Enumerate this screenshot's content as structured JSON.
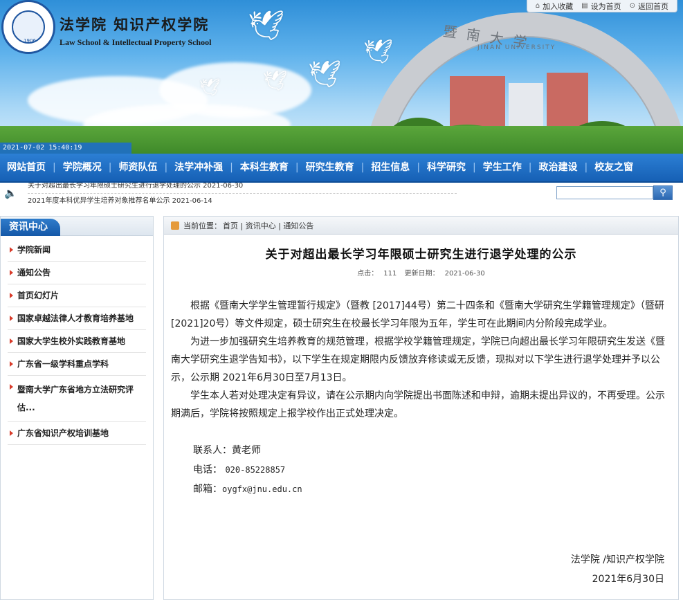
{
  "header": {
    "school_cn": "法学院  知识产权学院",
    "school_en": "Law School & Intellectual Property School",
    "logo_year": "1906",
    "logo_ring": "JINAN UNIVERSITY",
    "arch_text": "暨南大学",
    "arch_en": "JINAN UNIVERSITY",
    "datetime": "2021-07-02 15:40:19",
    "top_links": [
      {
        "label": "加入收藏",
        "icon": "home-icon"
      },
      {
        "label": "设为首页",
        "icon": "bookmark-icon"
      },
      {
        "label": "返回首页",
        "icon": "return-icon"
      }
    ]
  },
  "nav": {
    "items": [
      "网站首页",
      "学院概况",
      "师资队伍",
      "法学冲补强",
      "本科生教育",
      "研究生教育",
      "招生信息",
      "科学研究",
      "学生工作",
      "政治建设",
      "校友之窗"
    ]
  },
  "marquee": {
    "items": [
      "关于对超出最长学习年限硕士研究生进行退学处理的公示  2021-06-30",
      "2021年度本科优异学生培养对象推荐名单公示  2021-06-14"
    ]
  },
  "search": {
    "placeholder": "",
    "button_icon": "search-icon"
  },
  "sidebar": {
    "title": "资讯中心",
    "items": [
      "学院新闻",
      "通知公告",
      "首页幻灯片",
      "国家卓越法律人才教育培养基地",
      "国家大学生校外实践教育基地",
      "广东省一级学科重点学科",
      "暨南大学广东省地方立法研究评估...",
      "广东省知识产权培训基地"
    ]
  },
  "breadcrumb": {
    "label": "当前位置：",
    "path": "首页 | 资讯中心 | 通知公告"
  },
  "article": {
    "title": "关于对超出最长学习年限硕士研究生进行退学处理的公示",
    "clicks_label": "点击：",
    "clicks": "111",
    "updated_label": "更新日期：",
    "updated": "2021-06-30",
    "paragraphs": [
      "根据《暨南大学学生管理暂行规定》（暨教 [2017]44号）第二十四条和《暨南大学研究生学籍管理规定》（暨研[2021]20号）等文件规定，硕士研究生在校最长学习年限为五年，学生可在此期间内分阶段完成学业。",
      "为进一步加强研究生培养教育的规范管理，根据学校学籍管理规定，学院已向超出最长学习年限研究生发送《暨南大学研究生退学告知书》，以下学生在规定期限内反馈放弃修读或无反馈，现拟对以下学生进行退学处理并予以公示，公示期 2021年6月30日至7月13日。",
      "学生本人若对处理决定有异议，请在公示期内向学院提出书面陈述和申辩，逾期未提出异议的，不再受理。公示期满后，学院将按照规定上报学校作出正式处理决定。"
    ],
    "contact_person_label": "联系人：",
    "contact_person": "黄老师",
    "phone_label": "电话：",
    "phone": "020-85228857",
    "email_label": "邮箱：",
    "email": "oygfx@jnu.edu.cn",
    "signature": "法学院 /知识产权学院",
    "sign_date": "2021年6月30日"
  }
}
